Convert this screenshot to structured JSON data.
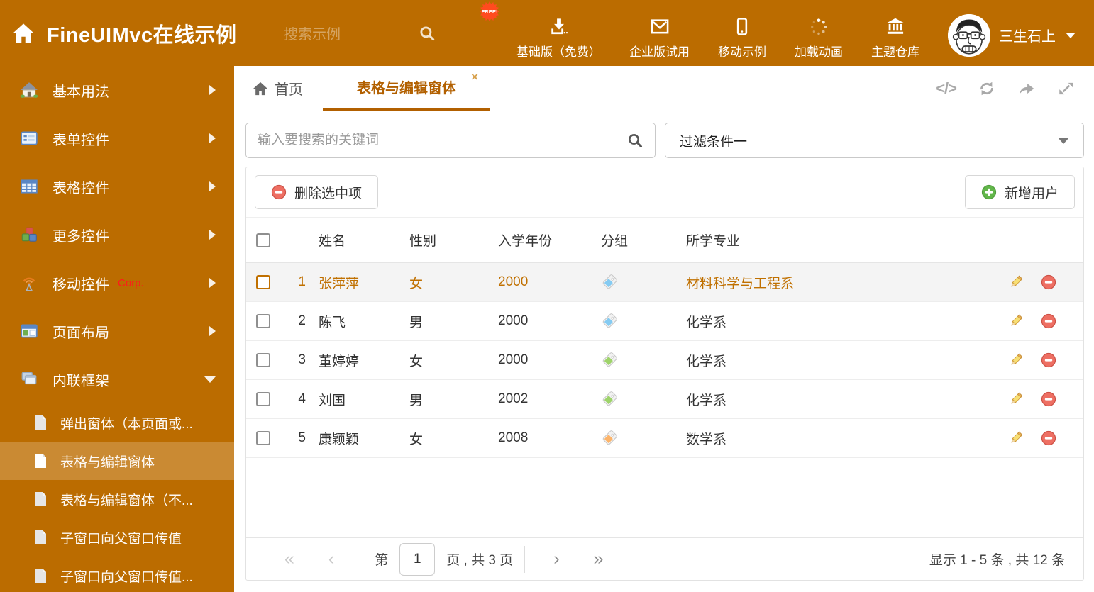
{
  "theme": {
    "header_bg": "#bb6c00",
    "sidebar_selected_bg": "#ca8a33",
    "accent": "#b26000",
    "selected_row_text": "#c07000",
    "free_badge_bg": "#ff4b1f"
  },
  "header": {
    "title": "FineUIMvc在线示例",
    "search_placeholder": "搜索示例",
    "free_badge": "FREE!",
    "nav_items": [
      {
        "label": "基础版（免费）",
        "icon": "download-icon"
      },
      {
        "label": "企业版试用",
        "icon": "envelope-icon"
      },
      {
        "label": "移动示例",
        "icon": "mobile-icon"
      },
      {
        "label": "加载动画",
        "icon": "spinner-icon"
      },
      {
        "label": "主题仓库",
        "icon": "bank-icon"
      }
    ],
    "user": {
      "name": "三生石上"
    }
  },
  "sidebar": {
    "items": [
      {
        "label": "基本用法",
        "icon": "house-icon"
      },
      {
        "label": "表单控件",
        "icon": "form-icon"
      },
      {
        "label": "表格控件",
        "icon": "table-icon"
      },
      {
        "label": "更多控件",
        "icon": "cubes-icon"
      },
      {
        "label": "移动控件",
        "badge": "Corp.",
        "icon": "antenna-icon"
      },
      {
        "label": "页面布局",
        "icon": "layout-icon"
      },
      {
        "label": "内联框架",
        "icon": "frames-icon"
      }
    ],
    "subitems": [
      {
        "label": "弹出窗体（本页面或..."
      },
      {
        "label": "表格与编辑窗体"
      },
      {
        "label": "表格与编辑窗体（不..."
      },
      {
        "label": "子窗口向父窗口传值"
      },
      {
        "label": "子窗口向父窗口传值..."
      }
    ]
  },
  "tabs": {
    "home": "首页",
    "active": "表格与编辑窗体",
    "close_icon": "×",
    "code_icon": "</>"
  },
  "filters": {
    "search_placeholder": "输入要搜索的关键词",
    "filter_value": "过滤条件一"
  },
  "toolbar": {
    "delete_label": "删除选中项",
    "add_label": "新增用户"
  },
  "grid": {
    "columns": {
      "name": "姓名",
      "gender": "性别",
      "year": "入学年份",
      "group": "分组",
      "major": "所学专业"
    },
    "rows": [
      {
        "num": "1",
        "name": "张萍萍",
        "gender": "女",
        "year": "2000",
        "tag_color": "#85cbf2",
        "major": "材料科学与工程系"
      },
      {
        "num": "2",
        "name": "陈飞",
        "gender": "男",
        "year": "2000",
        "tag_color": "#85cbf2",
        "major": "化学系"
      },
      {
        "num": "3",
        "name": "董婷婷",
        "gender": "女",
        "year": "2000",
        "tag_color": "#9ed36a",
        "major": "化学系"
      },
      {
        "num": "4",
        "name": "刘国",
        "gender": "男",
        "year": "2002",
        "tag_color": "#9ed36a",
        "major": "化学系"
      },
      {
        "num": "5",
        "name": "康颖颖",
        "gender": "女",
        "year": "2008",
        "tag_color": "#fcb46a",
        "major": "数学系"
      }
    ]
  },
  "pagination": {
    "first": "«",
    "prev": "‹",
    "next": "›",
    "last": "»",
    "prefix": "第",
    "page": "1",
    "suffix": "页 , 共 3 页",
    "summary": "显示 1 - 5 条 , 共 12 条"
  }
}
